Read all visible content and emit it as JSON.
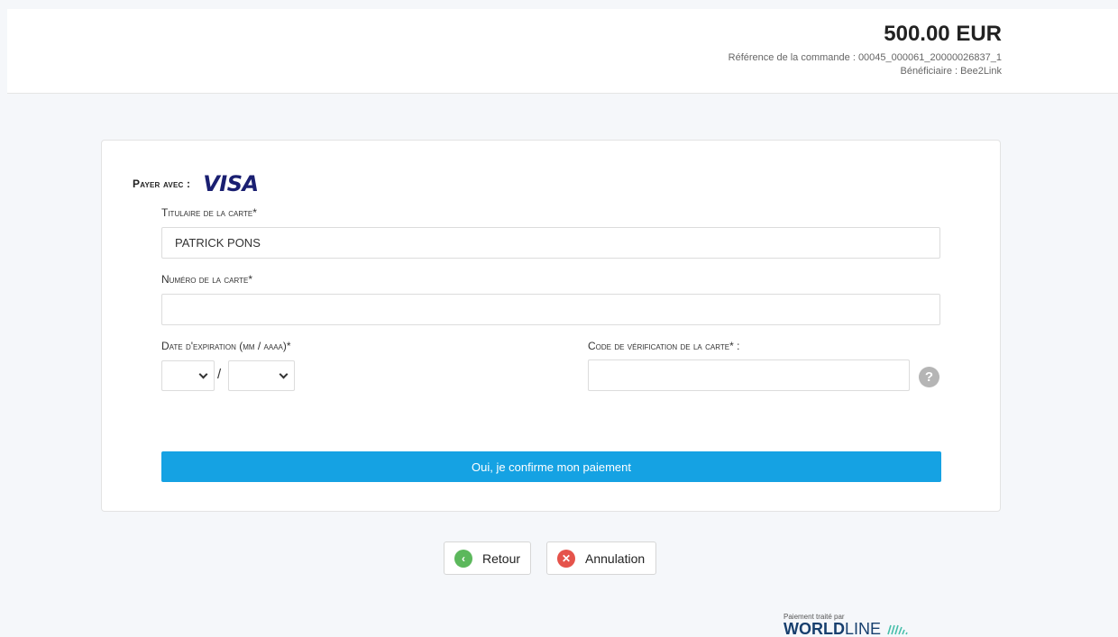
{
  "header": {
    "amount": "500.00 EUR",
    "order_reference": "Référence de la commande : 00045_000061_20000026837_1",
    "beneficiary": "Bénéficiaire : Bee2Link"
  },
  "form": {
    "pay_with_label": "Payer avec :",
    "card_brand": "VISA",
    "holder_label": "Titulaire de la carte*",
    "holder_value": "PATRICK PONS",
    "number_label": "Numéro de la carte*",
    "number_value": "",
    "expiry_label": "Date d'expiration (mm / aaaa)*",
    "expiry_separator": "/",
    "expiry_month_value": "",
    "expiry_year_value": "",
    "cvv_label": "Code de vérification de la carte* :",
    "cvv_value": "",
    "help_icon": "question-circle",
    "confirm_label": "Oui, je confirme mon paiement"
  },
  "navigation": {
    "back_label": "Retour",
    "cancel_label": "Annulation"
  },
  "footer": {
    "processed_by": "Paiement traité par",
    "brand_bold": "WORLD",
    "brand_light": "LINE"
  },
  "colors": {
    "confirm_button": "#15a2e3",
    "back_icon": "#5cb85c",
    "cancel_icon": "#e5534b",
    "visa_blue": "#1a1f71",
    "worldline_teal": "#46beaa"
  }
}
